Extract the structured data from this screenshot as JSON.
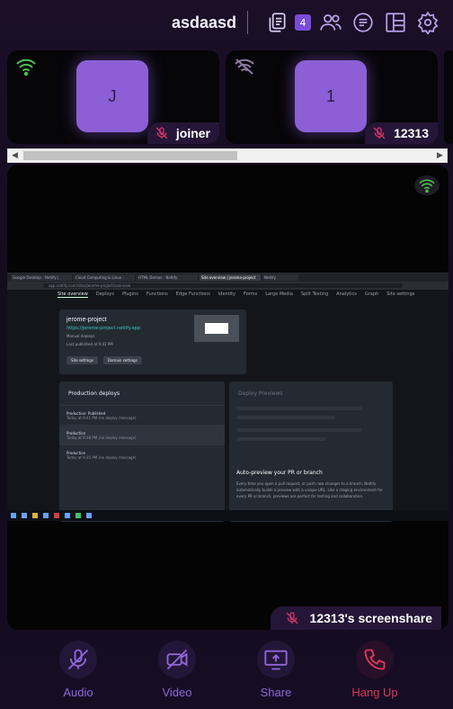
{
  "header": {
    "room_name": "asdaasd",
    "badge_count": "4",
    "icons": [
      "copy-icon",
      "participants-icon",
      "chat-icon",
      "layout-icon",
      "settings-icon"
    ]
  },
  "participants": [
    {
      "initial": "J",
      "name": "joiner",
      "signal": "good",
      "mic": "muted"
    },
    {
      "initial": "1",
      "name": "12313",
      "signal": "weak",
      "mic": "muted"
    }
  ],
  "main": {
    "label": "12313's screenshare",
    "signal": "good",
    "mic": "muted",
    "screen": {
      "tabs": [
        "Google Desktop - Netlify | Google",
        "Cloud Computing & Linux - Google",
        "HTML Demos - Netlify",
        "Site overview | jerome-project",
        "Netlify"
      ],
      "url": "app.netlify.com/sites/jerome-project/overview",
      "nav": [
        "Site overview",
        "Deploys",
        "Plugins",
        "Functions",
        "Edge Functions",
        "Identity",
        "Forms",
        "Large Media",
        "Split Testing",
        "Analytics",
        "Graph",
        "Site settings"
      ],
      "site": {
        "title": "jerome-project",
        "url": "https://jerome-project.netlify.app",
        "line1": "Manual deploys",
        "line2": "Last published at 9:41 PM",
        "buttons": [
          "Site settings",
          "Domain settings"
        ]
      },
      "deploys": {
        "title": "Production deploys",
        "rows": [
          {
            "title": "Production: Published",
            "sub": "Today at 9:41 PM (no deploy message)"
          },
          {
            "title": "Production",
            "sub": "Today at 9:38 PM (no deploy message)"
          },
          {
            "title": "Production",
            "sub": "Today at 9:35 PM (no deploy message)"
          }
        ]
      },
      "previews": {
        "title": "Deploy Previews",
        "headline": "Auto-preview your PR or branch",
        "body": "Every time you open a pull request, or push new changes to a branch, Netlify automatically builds a preview with a unique URL. Like a staging environment for every PR or branch, previews are perfect for testing and collaboration."
      }
    }
  },
  "controls": [
    {
      "label": "Audio",
      "state": "off"
    },
    {
      "label": "Video",
      "state": "off"
    },
    {
      "label": "Share",
      "state": "available"
    },
    {
      "label": "Hang Up",
      "state": "danger"
    }
  ],
  "colors": {
    "accent": "#8f67d8",
    "danger": "#e0365f",
    "signal_good": "#4cc24c",
    "avatar": "#8c5fd6"
  }
}
